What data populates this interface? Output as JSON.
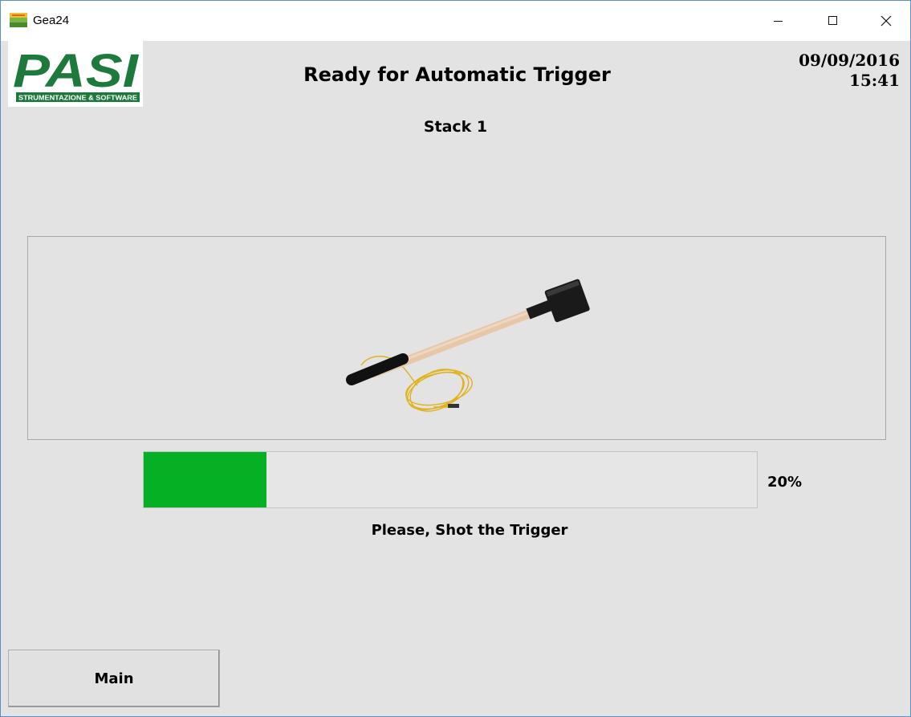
{
  "window": {
    "title": "Gea24",
    "controls": [
      "minimize-icon",
      "maximize-icon",
      "close-icon"
    ]
  },
  "logo": {
    "text": "PASI",
    "tagline": "STRUMENTAZIONE & SOFTWARE",
    "color": "#1e7a3c"
  },
  "header": {
    "title": "Ready for Automatic Trigger",
    "stack": "Stack 1",
    "date": "09/09/2016",
    "time": "15:41"
  },
  "image": {
    "subject": "sledgehammer-trigger-icon"
  },
  "progress": {
    "percent": 20,
    "label": "20%",
    "color": "#06b025",
    "message": "Please, Shot the Trigger"
  },
  "buttons": {
    "main_label": "Main"
  }
}
